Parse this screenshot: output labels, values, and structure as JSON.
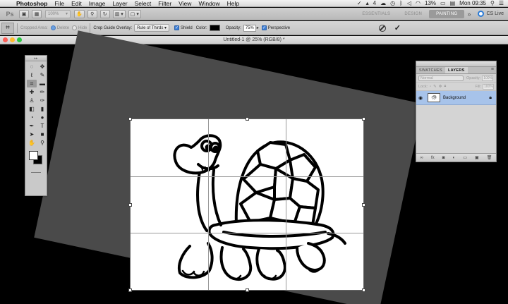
{
  "menubar": {
    "app": "Photoshop",
    "items": [
      "File",
      "Edit",
      "Image",
      "Layer",
      "Select",
      "Filter",
      "View",
      "Window",
      "Help"
    ],
    "status": {
      "badge": "4",
      "battery": "13%",
      "clock": "Mon 09:35"
    }
  },
  "appbar": {
    "logo": "Ps",
    "zoom": "100%",
    "workspaces": [
      "ESSENTIALS",
      "DESIGN",
      "PAINTING"
    ],
    "active_workspace": "PAINTING",
    "more": "»",
    "cs_live": "CS Live"
  },
  "options": {
    "cropped_area_label": "Cropped Area:",
    "delete_label": "Delete",
    "hide_label": "Hide",
    "overlay_label": "Crop Guide Overlay:",
    "overlay_value": "Rule of Thirds",
    "shield_label": "Shield",
    "color_label": "Color:",
    "shield_color": "#000000",
    "opacity_label": "Opacity:",
    "opacity_value": "75%",
    "perspective_label": "Perspective"
  },
  "document": {
    "title": "Untitled-1 @ 25% (RGB/8) *"
  },
  "layers_panel": {
    "tabs": [
      "SWATCHES",
      "LAYERS"
    ],
    "active_tab": "LAYERS",
    "blend_mode": "Normal",
    "opacity_label": "Opacity:",
    "opacity_value": "100%",
    "lock_label": "Lock:",
    "fill_label": "Fill:",
    "fill_value": "100%",
    "layers": [
      {
        "name": "Background",
        "visible": true,
        "locked": true
      }
    ]
  },
  "colors": {
    "foreground": "#ffffff",
    "background": "#000000",
    "selection": "#a7c3ea"
  }
}
